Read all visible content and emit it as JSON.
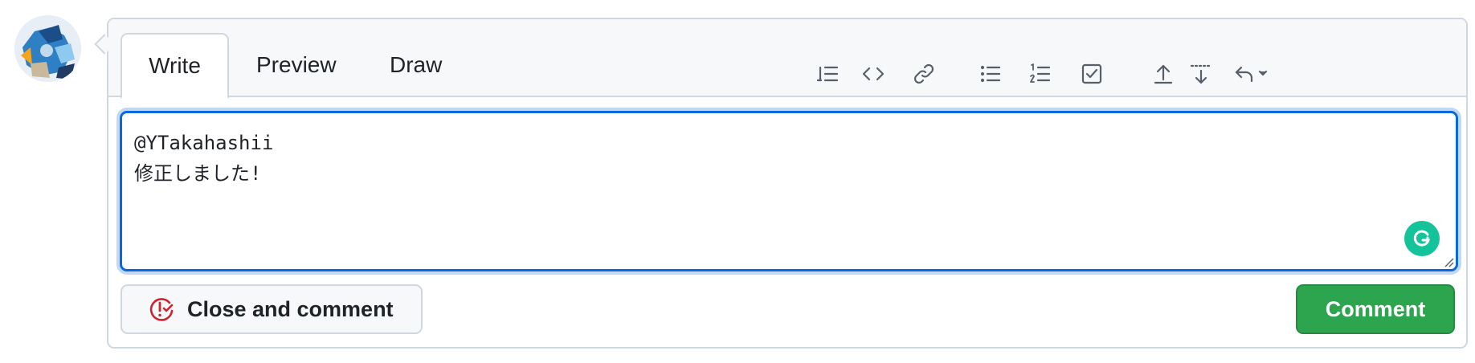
{
  "tabs": [
    {
      "label": "Write",
      "active": true
    },
    {
      "label": "Preview",
      "active": false
    },
    {
      "label": "Draw",
      "active": false
    }
  ],
  "toolbar": {
    "icons": [
      "heading-icon",
      "code-icon",
      "link-icon",
      "bulleted-list-icon",
      "numbered-list-icon",
      "task-list-icon",
      "upload-icon",
      "collapse-icon",
      "reply-icon"
    ]
  },
  "editor": {
    "line1": "@YTakahashii",
    "line2": "修正しました!"
  },
  "buttons": {
    "close_label": "Close and comment",
    "comment_label": "Comment"
  },
  "colors": {
    "accent": "#0969da",
    "primary_button": "#2da44e",
    "close_icon": "#cf222e",
    "grammarly": "#15c39a"
  }
}
